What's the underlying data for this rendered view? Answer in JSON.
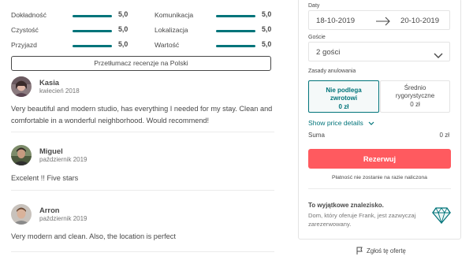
{
  "ratings": [
    {
      "name": "Dokładność",
      "value": "5,0",
      "score": 5.0
    },
    {
      "name": "Czystość",
      "value": "5,0",
      "score": 5.0
    },
    {
      "name": "Przyjazd",
      "value": "5,0",
      "score": 5.0
    },
    {
      "name": "Komunikacja",
      "value": "5,0",
      "score": 5.0
    },
    {
      "name": "Lokalizacja",
      "value": "5,0",
      "score": 5.0
    },
    {
      "name": "Wartość",
      "value": "5,0",
      "score": 5.0
    }
  ],
  "translate_button": "Przetłumacz recenzje na Polski",
  "reviews": [
    {
      "name": "Kasia",
      "date": "kwiecień 2018",
      "text": "Very beautiful and modern studio, has everything I needed for my stay. Clean and comfortable in a wonderful neighborhood. Would recommend!"
    },
    {
      "name": "Miguel",
      "date": "październik 2019",
      "text": "Excelent !! Five stars"
    },
    {
      "name": "Arron",
      "date": "październik 2019",
      "text": "Very modern and clean. Also, the location is perfect"
    }
  ],
  "booking": {
    "dates_label": "Daty",
    "check_in": "18-10-2019",
    "check_out": "20-10-2019",
    "guests_label": "Goście",
    "guests_value": "2 gości",
    "cancellation_label": "Zasady anulowania",
    "policy_nonrefundable": {
      "line1": "Nie podlega",
      "line2": "zwrotowi",
      "price": "0 zł"
    },
    "policy_moderate": {
      "line1": "Średnio",
      "line2": "rygorystyczne",
      "price": "0 zł"
    },
    "show_price": "Show price details",
    "total_label": "Suma",
    "total_value": "0 zł",
    "reserve_button": "Rezerwuj",
    "no_charge": "Płatność nie zostanie na razie naliczona",
    "rare_title": "To wyjątkowe znalezisko.",
    "rare_text": "Dom, który oferuje Frank, jest zazwyczaj zarezerwowany."
  },
  "report_link": "Zgłoś tę ofertę",
  "colors": {
    "accent": "#00747a",
    "brand": "#ff5a5f",
    "text": "#484848",
    "muted": "#767676"
  }
}
